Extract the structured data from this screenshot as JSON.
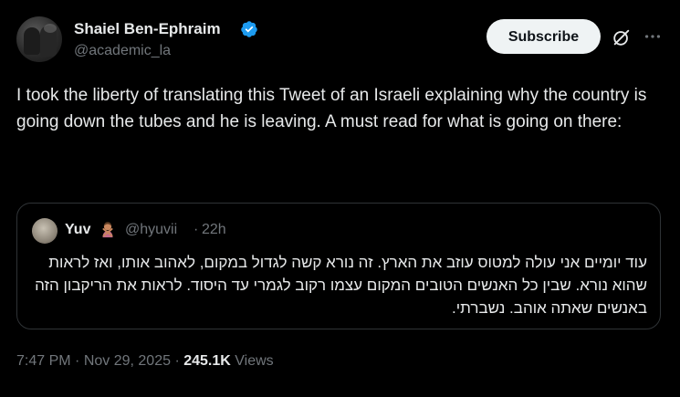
{
  "author": {
    "name": "Shaiel Ben-Ephraim",
    "handle": "@academic_la",
    "verified": true
  },
  "actions": {
    "subscribe_label": "Subscribe",
    "grok_icon": "grok-icon",
    "more_icon": "more-icon"
  },
  "tweet": {
    "text": "I took the liberty of translating this Tweet of an Israeli explaining why the country is going down the tubes and he is leaving. A must read for what is going on there:"
  },
  "quote": {
    "name": "Yuv",
    "emoji": "person-gesturing-no-emoji",
    "handle": "@hyuvii",
    "separator": "·",
    "time": "22h",
    "text": "עוד יומיים אני עולה למטוס עוזב את הארץ. זה נורא קשה לגדול במקום, לאהוב אותו, ואז לראות שהוא נורא. שבין כל האנשים הטובים המקום עצמו רקוב לגמרי עד היסוד. לראות את הריקבון הזה באנשים שאתה אוהב. נשברתי."
  },
  "meta": {
    "time": "7:47 PM",
    "sep1": " · ",
    "date": "Nov 29, 2025",
    "sep2": " · ",
    "views_count": "245.1K",
    "views_label": " Views"
  },
  "colors": {
    "background": "#000000",
    "text": "#e7e9ea",
    "muted": "#71767b",
    "verified": "#1d9bf0",
    "border": "#2f3336",
    "button_bg": "#eff3f4"
  }
}
